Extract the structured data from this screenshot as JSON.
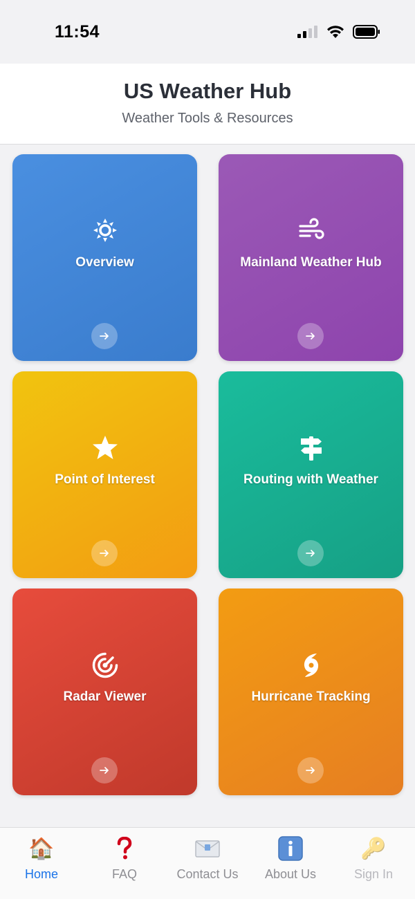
{
  "status_bar": {
    "time": "11:54",
    "icons": [
      "cellular-signal-icon",
      "wifi-icon",
      "battery-icon"
    ]
  },
  "header": {
    "title": "US Weather Hub",
    "subtitle": "Weather Tools & Resources"
  },
  "cards": [
    {
      "label": "Overview",
      "icon": "sun-gear-icon",
      "color_start": "#4a8fe0",
      "color_end": "#3a7ccd"
    },
    {
      "label": "Mainland Weather Hub",
      "icon": "wind-icon",
      "color_start": "#9b59b6",
      "color_end": "#8e44ad"
    },
    {
      "label": "Point of Interest",
      "icon": "star-icon",
      "color_start": "#f1c40f",
      "color_end": "#f39c12"
    },
    {
      "label": "Routing with Weather",
      "icon": "signpost-icon",
      "color_start": "#1abc9c",
      "color_end": "#16a085"
    },
    {
      "label": "Radar Viewer",
      "icon": "radar-icon",
      "color_start": "#e74c3c",
      "color_end": "#c0392b"
    },
    {
      "label": "Hurricane Tracking",
      "icon": "hurricane-icon",
      "color_start": "#f39c12",
      "color_end": "#e67e22"
    }
  ],
  "tab_bar": {
    "items": [
      {
        "label": "Home",
        "icon": "house-icon",
        "state": "active"
      },
      {
        "label": "FAQ",
        "icon": "question-mark-icon",
        "state": "normal"
      },
      {
        "label": "Contact Us",
        "icon": "envelope-icon",
        "state": "normal"
      },
      {
        "label": "About Us",
        "icon": "info-icon",
        "state": "normal"
      },
      {
        "label": "Sign In",
        "icon": "key-icon",
        "state": "disabled"
      }
    ]
  },
  "colors": {
    "accent": "#1a73e8",
    "title": "#2b2f38",
    "background": "#f2f2f4"
  }
}
